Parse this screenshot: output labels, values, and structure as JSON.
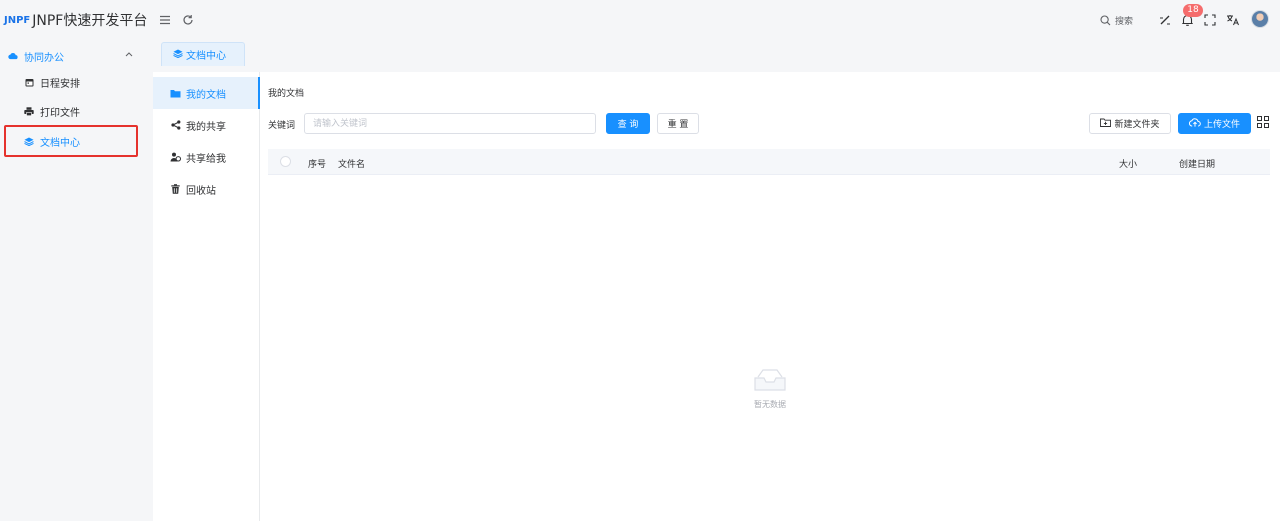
{
  "header": {
    "logo_mark": "JNPF",
    "title": "JNPF快速开发平台",
    "search_label": "搜索",
    "notification_count": "18",
    "icons": [
      "menu-icon",
      "refresh-icon",
      "search-icon",
      "brush-icon",
      "bell-icon",
      "fullscreen-icon",
      "translate-icon",
      "avatar"
    ]
  },
  "sidebar": {
    "group_label": "协同办公",
    "items": [
      {
        "label": "日程安排",
        "icon": "calendar-icon"
      },
      {
        "label": "打印文件",
        "icon": "printer-icon"
      },
      {
        "label": "文档中心",
        "icon": "layers-icon",
        "active": true
      }
    ]
  },
  "tabs": [
    {
      "label": "文档中心",
      "icon": "layers-icon",
      "active": true
    }
  ],
  "doc_nav": [
    {
      "label": "我的文档",
      "icon": "folder-icon",
      "active": true
    },
    {
      "label": "我的共享",
      "icon": "share-icon"
    },
    {
      "label": "共享给我",
      "icon": "users-icon"
    },
    {
      "label": "回收站",
      "icon": "trash-icon"
    }
  ],
  "main": {
    "breadcrumb": "我的文档",
    "keyword_label": "关键词",
    "keyword_placeholder": "请输入关键词",
    "keyword_value": "",
    "query_button": "查 询",
    "reset_button": "重 置",
    "new_folder_button": "新建文件夹",
    "upload_button": "上传文件"
  },
  "table": {
    "columns": [
      "序号",
      "文件名",
      "大小",
      "创建日期"
    ],
    "rows": [],
    "empty_text": "暂无数据"
  },
  "colors": {
    "accent": "#1890ff",
    "highlight_box": "#e5322d",
    "badge": "#f56c6c"
  }
}
